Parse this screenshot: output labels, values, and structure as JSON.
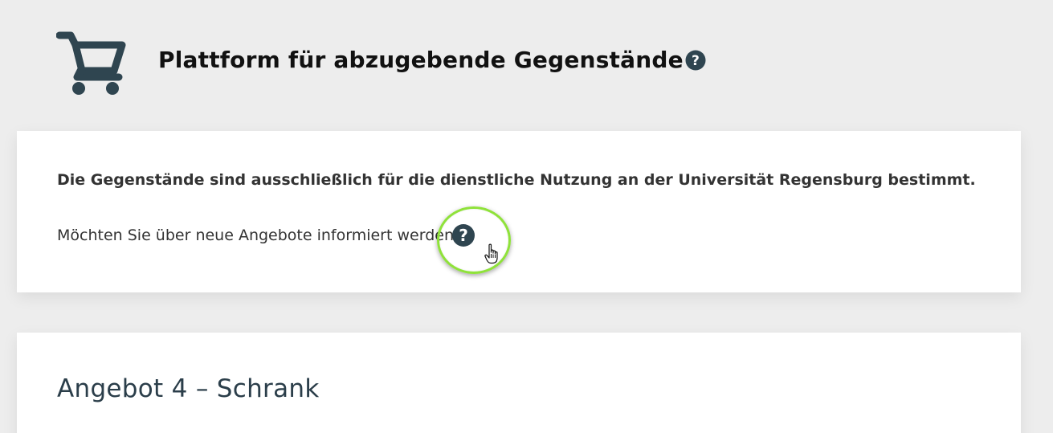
{
  "header": {
    "title": "Plattform für abzugebende Gegenstände",
    "logo_icon": "shopping-cart-icon",
    "title_help_icon": "question-circle-icon"
  },
  "info_card": {
    "notice": "Die Gegenstände sind ausschließlich für die dienstliche Nutzung an der Universität Regensburg bestimmt.",
    "subscribe_text": "Möchten Sie über neue Angebote informiert werden",
    "subscribe_help_icon": "question-circle-icon"
  },
  "offer_card": {
    "title": "Angebot 4 – Schrank"
  },
  "colors": {
    "background": "#ededed",
    "card": "#ffffff",
    "icon": "#2f4550",
    "highlight": "#8fe23a",
    "title_text": "#111111",
    "offer_title": "#2b3e4a"
  }
}
